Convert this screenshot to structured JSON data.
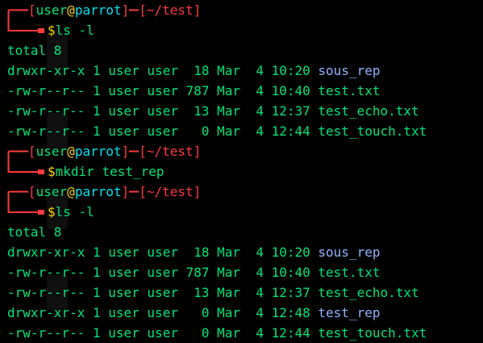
{
  "prompt": {
    "user": "user",
    "at": "@",
    "host": "parrot",
    "path": "~/test",
    "dollar": "$"
  },
  "blocks": [
    {
      "command": "ls -l",
      "total": "total 8",
      "rows": [
        {
          "perms": "drwxr-xr-x",
          "links": "1",
          "owner": "user",
          "group": "user",
          "size": " 18",
          "month": "Mar",
          "day": " 4",
          "time": "10:20",
          "name": "sous_rep",
          "kind": "dir"
        },
        {
          "perms": "-rw-r--r--",
          "links": "1",
          "owner": "user",
          "group": "user",
          "size": "787",
          "month": "Mar",
          "day": " 4",
          "time": "10:40",
          "name": "test.txt",
          "kind": "file"
        },
        {
          "perms": "-rw-r--r--",
          "links": "1",
          "owner": "user",
          "group": "user",
          "size": " 13",
          "month": "Mar",
          "day": " 4",
          "time": "12:37",
          "name": "test_echo.txt",
          "kind": "file"
        },
        {
          "perms": "-rw-r--r--",
          "links": "1",
          "owner": "user",
          "group": "user",
          "size": "  0",
          "month": "Mar",
          "day": " 4",
          "time": "12:44",
          "name": "test_touch.txt",
          "kind": "file"
        }
      ]
    },
    {
      "command": "mkdir test_rep",
      "total": "",
      "rows": []
    },
    {
      "command": "ls -l",
      "total": "total 8",
      "rows": [
        {
          "perms": "drwxr-xr-x",
          "links": "1",
          "owner": "user",
          "group": "user",
          "size": " 18",
          "month": "Mar",
          "day": " 4",
          "time": "10:20",
          "name": "sous_rep",
          "kind": "dir"
        },
        {
          "perms": "-rw-r--r--",
          "links": "1",
          "owner": "user",
          "group": "user",
          "size": "787",
          "month": "Mar",
          "day": " 4",
          "time": "10:40",
          "name": "test.txt",
          "kind": "file"
        },
        {
          "perms": "-rw-r--r--",
          "links": "1",
          "owner": "user",
          "group": "user",
          "size": " 13",
          "month": "Mar",
          "day": " 4",
          "time": "12:37",
          "name": "test_echo.txt",
          "kind": "file"
        },
        {
          "perms": "drwxr-xr-x",
          "links": "1",
          "owner": "user",
          "group": "user",
          "size": "  0",
          "month": "Mar",
          "day": " 4",
          "time": "12:48",
          "name": "test_rep",
          "kind": "dir"
        },
        {
          "perms": "-rw-r--r--",
          "links": "1",
          "owner": "user",
          "group": "user",
          "size": "  0",
          "month": "Mar",
          "day": " 4",
          "time": "12:44",
          "name": "test_touch.txt",
          "kind": "file"
        }
      ]
    }
  ],
  "colors": {
    "background": "#000000",
    "prompt_frame": "#ff3b3b",
    "user": "#00e676",
    "at": "#ffd500",
    "host": "#00e2f5",
    "output": "#00e676",
    "directory": "#8fb4ff"
  }
}
